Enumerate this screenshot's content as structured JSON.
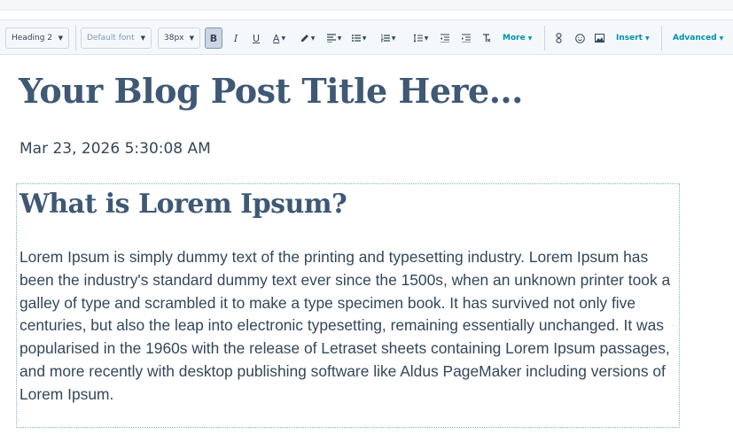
{
  "toolbar": {
    "block_style": "Heading 2",
    "font": "Default font",
    "font_size": "38px",
    "bold_glyph": "B",
    "italic_glyph": "I",
    "underline_glyph": "U",
    "text_color_glyph": "A",
    "more_label": "More",
    "insert_label": "Insert",
    "advanced_label": "Advanced"
  },
  "post": {
    "title": "Your Blog Post Title Here...",
    "date": "Mar 23, 2026 5:30:08 AM",
    "heading": "What is Lorem Ipsum?",
    "body": "Lorem Ipsum is simply dummy text of the printing and typesetting industry. Lorem Ipsum has been the industry's standard dummy text ever since the 1500s, when an unknown printer took a galley of type and scrambled it to make a type specimen book. It has survived not only five centuries, but also the leap into electronic typesetting, remaining essentially unchanged. It was popularised in the 1960s with the release of Letraset sheets containing Lorem Ipsum passages, and more recently with desktop publishing software like Aldus PageMaker including versions of Lorem Ipsum."
  }
}
